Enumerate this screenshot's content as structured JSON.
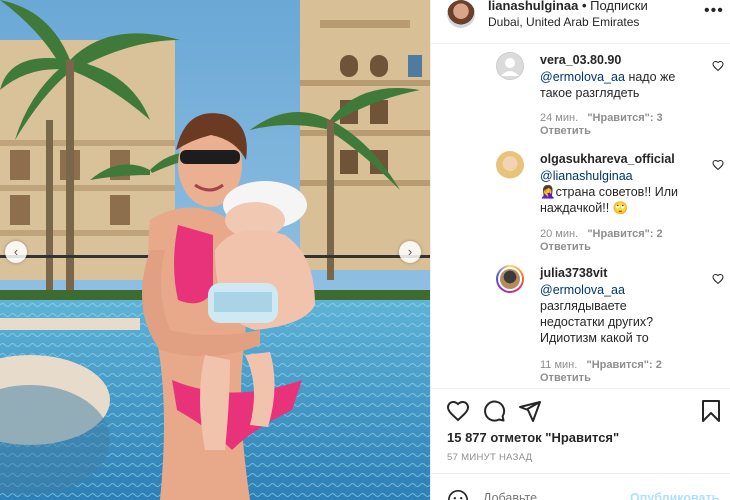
{
  "header": {
    "username": "lianashulginaa",
    "separator": "•",
    "follow_state": "Подписки",
    "location": "Dubai, United Arab Emirates",
    "more_icon": "more-dots-icon"
  },
  "comments": [
    {
      "username": "vera_03.80.90",
      "mention": "@ermolova_aa",
      "text_line1": " надо же",
      "text_line2": "такое разглядеть",
      "time": "24 мин.",
      "likes": "\"Нравится\": 3",
      "reply": "Ответить"
    },
    {
      "username": "olgasukhareva_official",
      "mention": "@lianashulginaa",
      "text_line1": "🤦‍♀️страна советов!! Или",
      "text_line2": "наждачкой!! 🙄",
      "time": "20 мин.",
      "likes": "\"Нравится\": 2",
      "reply": "Ответить"
    },
    {
      "username": "julia3738vit",
      "mention": "@ermolova_aa",
      "text_line1": "разглядываете",
      "text_line2": "недостатки других?",
      "text_line3": "Идиотизм какой то",
      "time": "11 мин.",
      "likes": "\"Нравится\": 2",
      "reply": "Ответить"
    }
  ],
  "post": {
    "likes": "15 877 отметок \"Нравится\"",
    "posted": "57 МИНУТ НАЗАД"
  },
  "add_comment": {
    "placeholder": "Добавьте...",
    "publish": "Опубликовать"
  },
  "colors": {
    "link": "#00376b",
    "meta": "#8e8e8e",
    "publish_disabled": "#b2dffc"
  }
}
